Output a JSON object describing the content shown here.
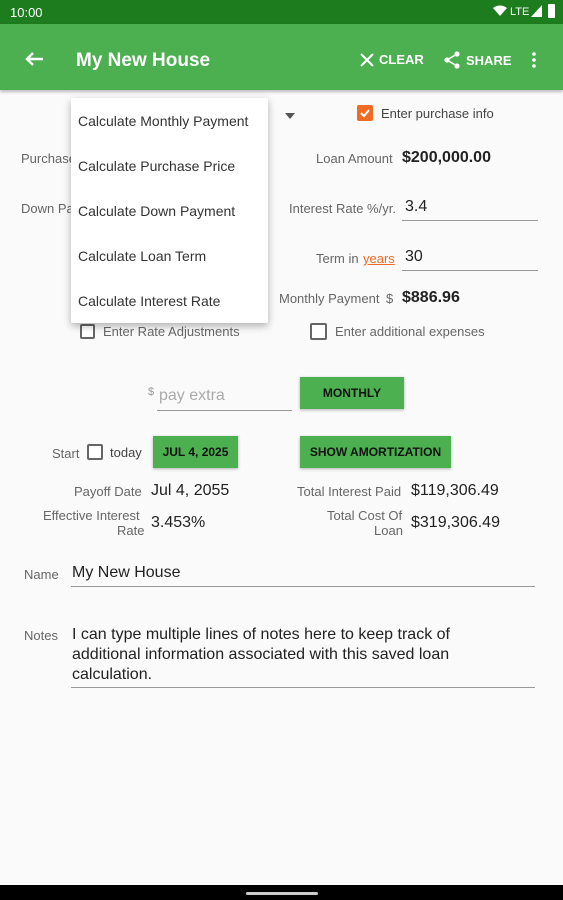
{
  "status": {
    "time": "10:00",
    "network": "LTE"
  },
  "appbar": {
    "title": "My New House",
    "clear_label": "CLEAR",
    "share_label": "SHARE"
  },
  "menu": {
    "items": [
      "Calculate Monthly Payment",
      "Calculate Purchase Price",
      "Calculate Down Payment",
      "Calculate Loan Term",
      "Calculate Interest Rate"
    ]
  },
  "left_partial": {
    "purchase": "Purchase",
    "down_pay": "Down Pay"
  },
  "purchase_info": {
    "label": "Enter purchase info",
    "checked": true
  },
  "loan": {
    "amount_label": "Loan Amount",
    "amount_value": "$200,000.00"
  },
  "interest": {
    "label": "Interest Rate %/yr.",
    "value": "3.4"
  },
  "term": {
    "label": "Term in",
    "unit_link": "years",
    "value": "30"
  },
  "monthly": {
    "label": "Monthly Payment",
    "currency": "$",
    "value": "$886.96"
  },
  "rate_adjustments": {
    "label": "Enter Rate Adjustments",
    "checked": false
  },
  "additional_expenses": {
    "label": "Enter additional expenses",
    "checked": false
  },
  "extra": {
    "currency": "$",
    "placeholder": "pay extra",
    "frequency_button": "MONTHLY"
  },
  "start": {
    "label": "Start",
    "today_label": "today",
    "date_button": "JUL 4, 2025",
    "amortization_button": "SHOW AMORTIZATION"
  },
  "results": {
    "payoff_label": "Payoff Date",
    "payoff_value": "Jul 4, 2055",
    "total_interest_label": "Total Interest Paid",
    "total_interest_value": "$119,306.49",
    "effective_label_1": "Effective Interest",
    "effective_label_2": "Rate",
    "effective_value": "3.453%",
    "total_cost_label_1": "Total Cost Of",
    "total_cost_label_2": "Loan",
    "total_cost_value": "$319,306.49"
  },
  "name": {
    "label": "Name",
    "value": "My New House"
  },
  "notes": {
    "label": "Notes",
    "lines": [
      "I can type multiple lines of notes here to keep track of",
      "additional information associated with this saved loan",
      "calculation."
    ]
  },
  "colors": {
    "primary": "#4caf50",
    "status_bar": "#1d7c1d",
    "accent": "#f26b22"
  }
}
